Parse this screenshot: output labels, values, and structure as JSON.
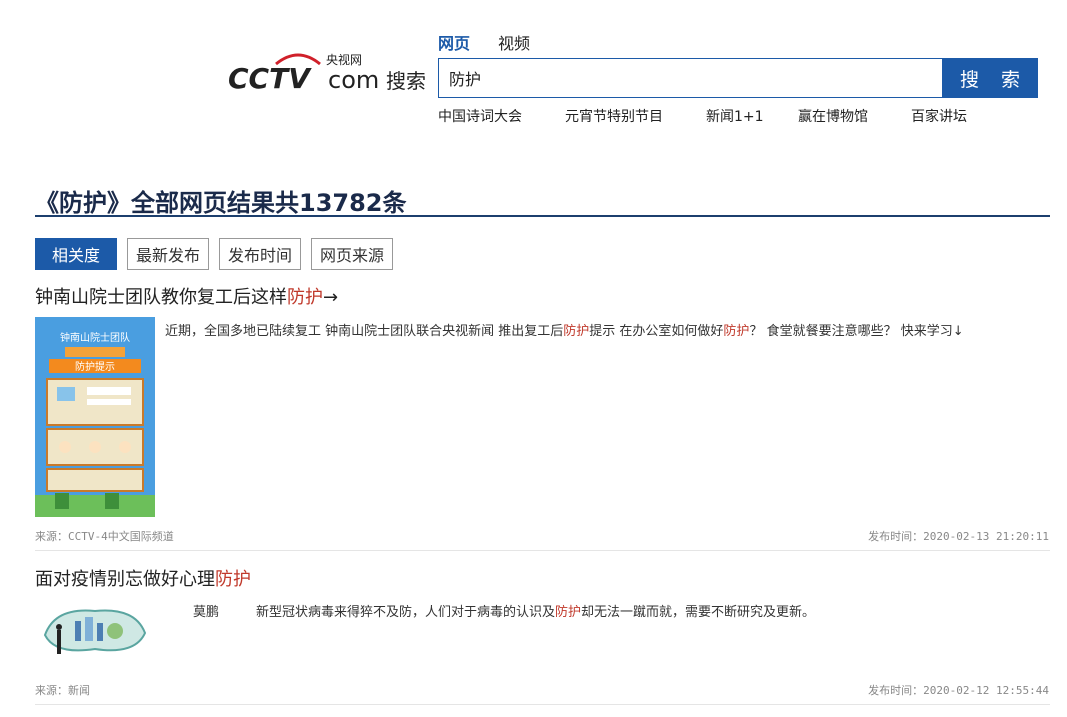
{
  "brand": {
    "logo_text": "CCTV",
    "logo_com": "com",
    "logo_cn": "央视网",
    "logo_sub": "搜索"
  },
  "type_tabs": [
    {
      "label": "网页",
      "active": true
    },
    {
      "label": "视频",
      "active": false
    }
  ],
  "search": {
    "query": "防护",
    "button_label": "搜 索"
  },
  "hot_links": [
    "中国诗词大会",
    "元宵节特别节目",
    "新闻1+1",
    "赢在博物馆",
    "百家讲坛"
  ],
  "result_header": {
    "text": "《防护》全部网页结果共13782条"
  },
  "sort_buttons": [
    {
      "label": "相关度",
      "active": true
    },
    {
      "label": "最新发布",
      "active": false
    },
    {
      "label": "发布时间",
      "active": false
    },
    {
      "label": "网页来源",
      "active": false
    }
  ],
  "results": [
    {
      "title_before": "钟南山院士团队教你复工后这样",
      "title_highlight": "防护",
      "title_after": "→",
      "desc_parts": [
        "近期，全国多地已陆续复工 钟南山院士团队联合央视新闻 推出复工后",
        "防护",
        "提示 在办公室如何做好",
        "防护",
        "？ 食堂就餐要注意哪些？ 快来学习↓"
      ],
      "thumb_texts": [
        "钟南山院士团队",
        "防护提示"
      ],
      "source": "来源：CCTV-4中文国际频道",
      "time": "发布时间：2020-02-13 21:20:11"
    },
    {
      "title_before": "面对疫情别忘做好心理",
      "title_highlight": "防护",
      "title_after": "",
      "author": "莫鹏",
      "desc_parts": [
        "新型冠状病毒来得猝不及防，人们对于病毒的认识及",
        "防护",
        "却无法一蹴而就，需要不断研究及更新。"
      ],
      "source": "来源：新闻",
      "time": "发布时间：2020-02-12 12:55:44"
    }
  ],
  "colors": {
    "accent": "#1c5aa8",
    "highlight": "#c0392b",
    "logo_red": "#d0202a"
  }
}
